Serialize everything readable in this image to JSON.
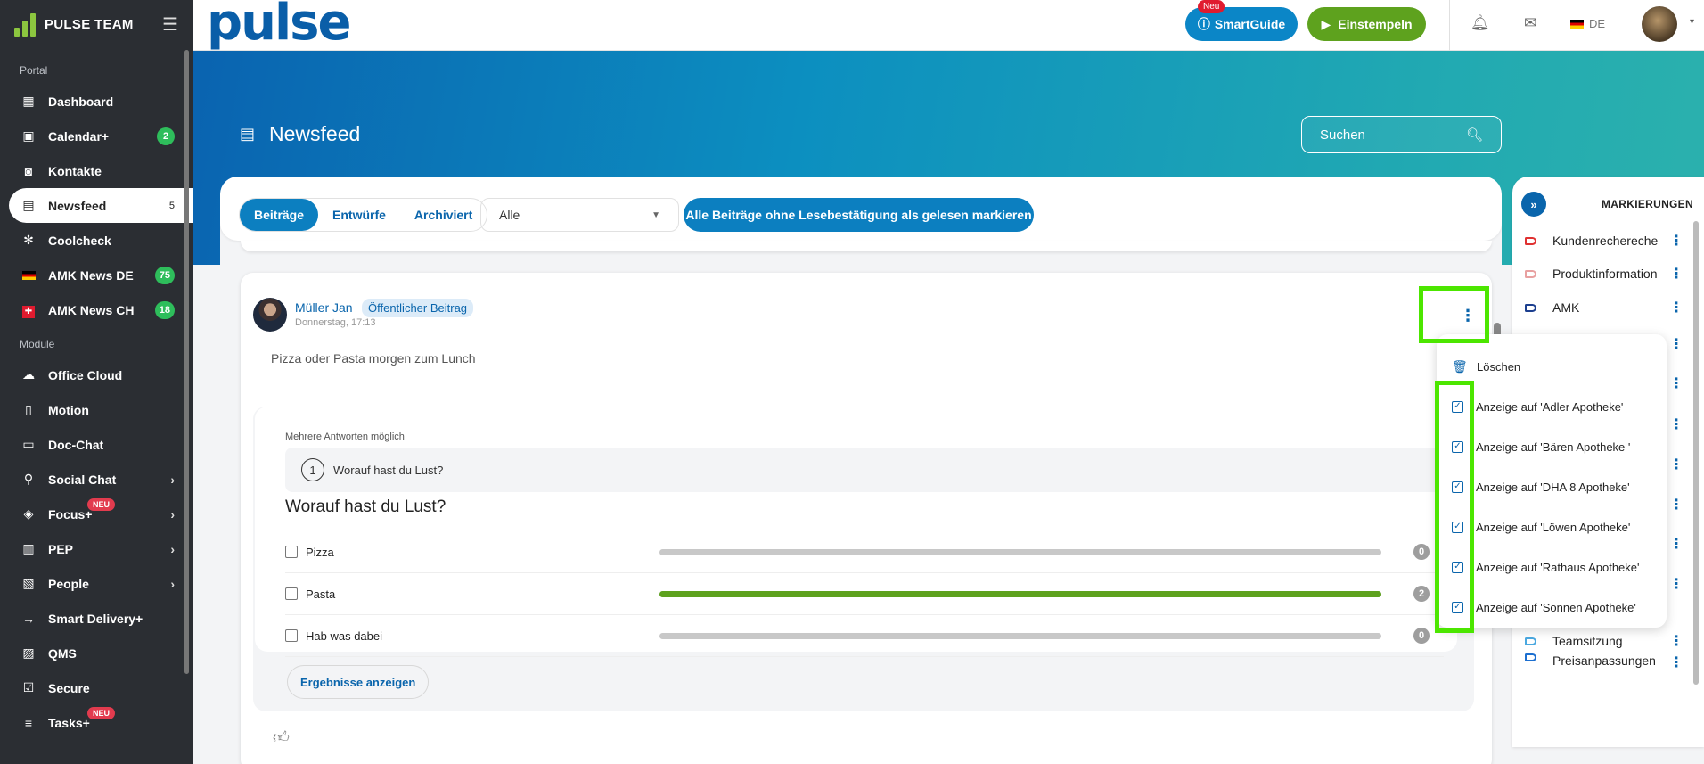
{
  "sidebar": {
    "brand": "PULSE TEAM",
    "section_portal": "Portal",
    "section_module": "Module",
    "portal_items": [
      {
        "label": "Dashboard",
        "icon": "dashboard-icon",
        "glyph": "▦"
      },
      {
        "label": "Calendar+",
        "icon": "calendar-icon",
        "glyph": "▣",
        "badge": "2"
      },
      {
        "label": "Kontakte",
        "icon": "contacts-icon",
        "glyph": "◙"
      },
      {
        "label": "Newsfeed",
        "icon": "newsfeed-icon",
        "glyph": "▤",
        "count": "5",
        "active": true
      },
      {
        "label": "Coolcheck",
        "icon": "snowflake-icon",
        "glyph": "✻"
      },
      {
        "label": "AMK News DE",
        "icon": "flag-de-icon",
        "glyph": "▬",
        "badge": "75"
      },
      {
        "label": "AMK News CH",
        "icon": "flag-ch-icon",
        "glyph": "✚",
        "badge": "18"
      }
    ],
    "module_items": [
      {
        "label": "Office Cloud",
        "icon": "cloud-icon",
        "glyph": "☁"
      },
      {
        "label": "Motion",
        "icon": "phone-icon",
        "glyph": "▯"
      },
      {
        "label": "Doc-Chat",
        "icon": "chat-icon",
        "glyph": "▭"
      },
      {
        "label": "Social Chat",
        "icon": "share-icon",
        "glyph": "⚲",
        "chevron": true
      },
      {
        "label": "Focus+",
        "icon": "graduation-icon",
        "glyph": "◈",
        "chevron": true,
        "neu": "NEU"
      },
      {
        "label": "PEP",
        "icon": "document-icon",
        "glyph": "▥",
        "chevron": true
      },
      {
        "label": "People",
        "icon": "people-icon",
        "glyph": "▧",
        "chevron": true
      },
      {
        "label": "Smart Delivery+",
        "icon": "arrow-right-icon",
        "glyph": "→"
      },
      {
        "label": "QMS",
        "icon": "book-icon",
        "glyph": "▨"
      },
      {
        "label": "Secure",
        "icon": "check-square-icon",
        "glyph": "☑"
      },
      {
        "label": "Tasks+",
        "icon": "list-icon",
        "glyph": "≡",
        "neu": "NEU"
      }
    ]
  },
  "topbar": {
    "logo": "pulse",
    "smartguide_label": "SmartGuide",
    "smartguide_badge": "Neu",
    "stamp_label": "Einstempeln",
    "lang": "DE"
  },
  "hero": {
    "title": "Newsfeed",
    "search_placeholder": "Suchen"
  },
  "filters": {
    "tabs": [
      "Beiträge",
      "Entwürfe",
      "Archiviert"
    ],
    "active_tab": 0,
    "select_value": "Alle",
    "mark_all_label": "Alle Beiträge ohne Lesebestätigung als gelesen markieren"
  },
  "post": {
    "author": "Müller Jan",
    "tag": "Öffentlicher Beitrag",
    "date": "Donnerstag, 17:13",
    "text": "Pizza oder Pasta morgen zum Lunch",
    "poll": {
      "hint": "Mehrere Antworten möglich",
      "step_number": "1",
      "step_question": "Worauf hast du Lust?",
      "question": "Worauf hast du Lust?",
      "options": [
        {
          "label": "Pizza",
          "votes": "0",
          "share": 0
        },
        {
          "label": "Pasta",
          "votes": "2",
          "share": 1
        },
        {
          "label": "Hab was dabei",
          "votes": "0",
          "share": 0
        }
      ],
      "results_label": "Ergebnisse anzeigen"
    }
  },
  "markings": {
    "title": "MARKIERUNGEN",
    "items": [
      {
        "label": "Kundenrechereche",
        "color": "#e03131"
      },
      {
        "label": "Produktinformation",
        "color": "#e8a0a0"
      },
      {
        "label": "AMK",
        "color": "#1c3f8f"
      },
      {
        "label": "Teamsitzung",
        "color": "#4aa8e0"
      },
      {
        "label": "Preisanpassungen",
        "color": "#1c6fd0"
      }
    ]
  },
  "menu": {
    "delete_label": "Löschen",
    "display_items": [
      "Anzeige auf 'Adler Apotheke'",
      "Anzeige auf 'Bären Apotheke '",
      "Anzeige auf 'DHA 8 Apotheke'",
      "Anzeige auf 'Löwen Apotheke'",
      "Anzeige auf 'Rathaus Apotheke'",
      "Anzeige auf 'Sonnen Apotheke'"
    ]
  },
  "colors": {
    "sidebar_bg": "#2b2e33",
    "brand_blue": "#0c7fc0",
    "brand_green": "#5ea21e",
    "highlight": "#4ce600"
  }
}
